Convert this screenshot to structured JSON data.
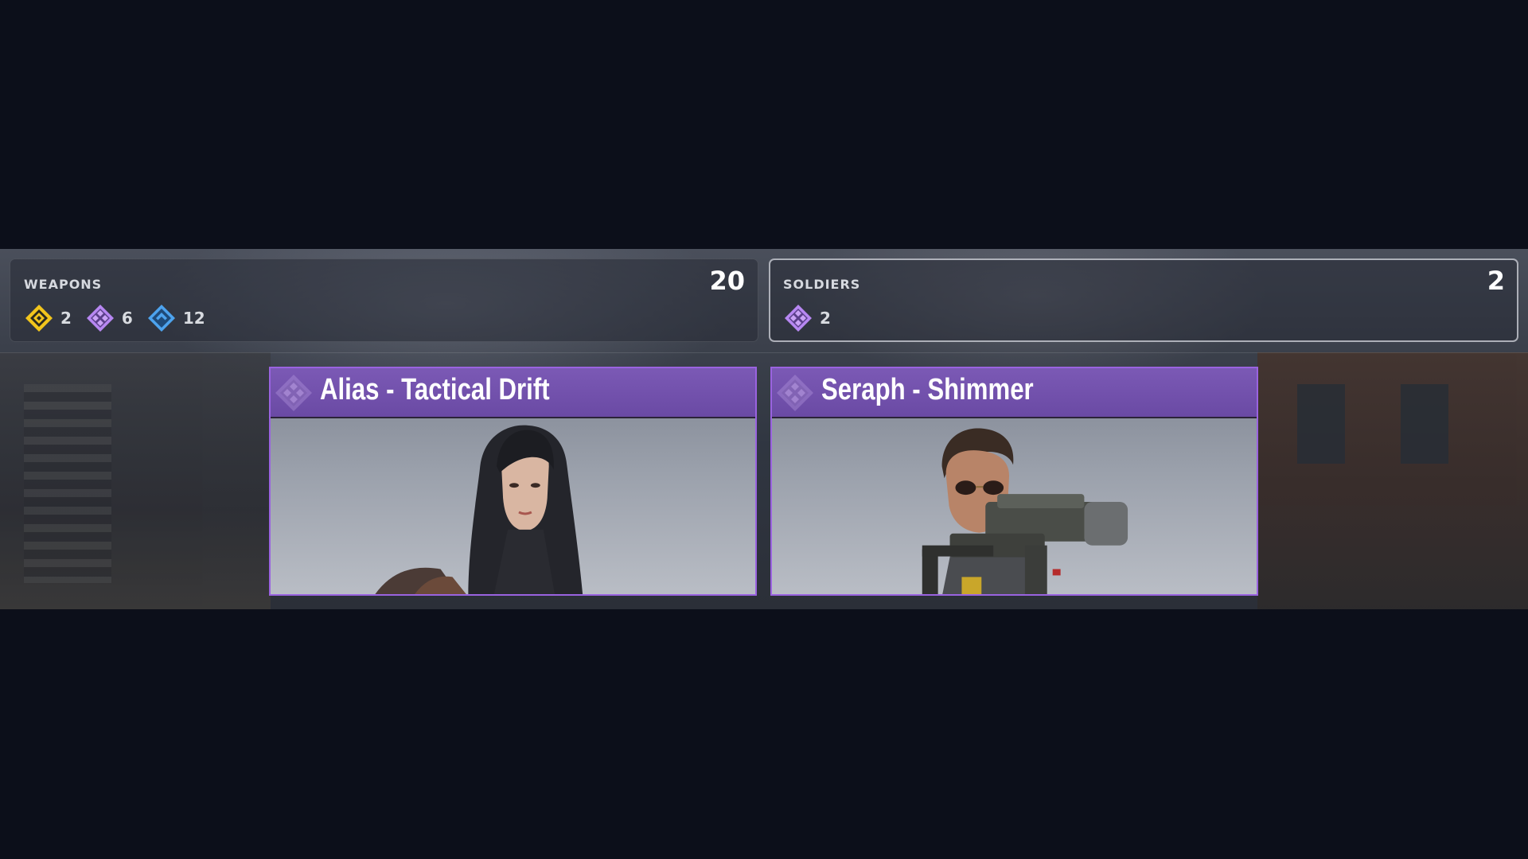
{
  "summary": {
    "weapons": {
      "title": "WEAPONS",
      "total": "20",
      "rarities": [
        {
          "icon": "gold-rarity-icon",
          "color": "#f2c51c",
          "count": "2"
        },
        {
          "icon": "purple-rarity-icon",
          "color": "#b787f2",
          "count": "6"
        },
        {
          "icon": "blue-rarity-icon",
          "color": "#4da3ee",
          "count": "12"
        }
      ]
    },
    "soldiers": {
      "title": "SOLDIERS",
      "total": "2",
      "rarities": [
        {
          "icon": "purple-rarity-icon",
          "color": "#b787f2",
          "count": "2"
        }
      ]
    }
  },
  "cards": [
    {
      "title": "Alias - Tactical Drift",
      "rarity_color": "#9a63e0",
      "portrait": "woman-long-black-hair-portrait"
    },
    {
      "title": "Seraph - Shimmer",
      "rarity_color": "#9a63e0",
      "portrait": "man-sunglasses-with-gun-portrait"
    }
  ],
  "colors": {
    "background": "#0c0f1a",
    "card_header": "#6a4aa4",
    "card_border": "#9a63e0"
  }
}
